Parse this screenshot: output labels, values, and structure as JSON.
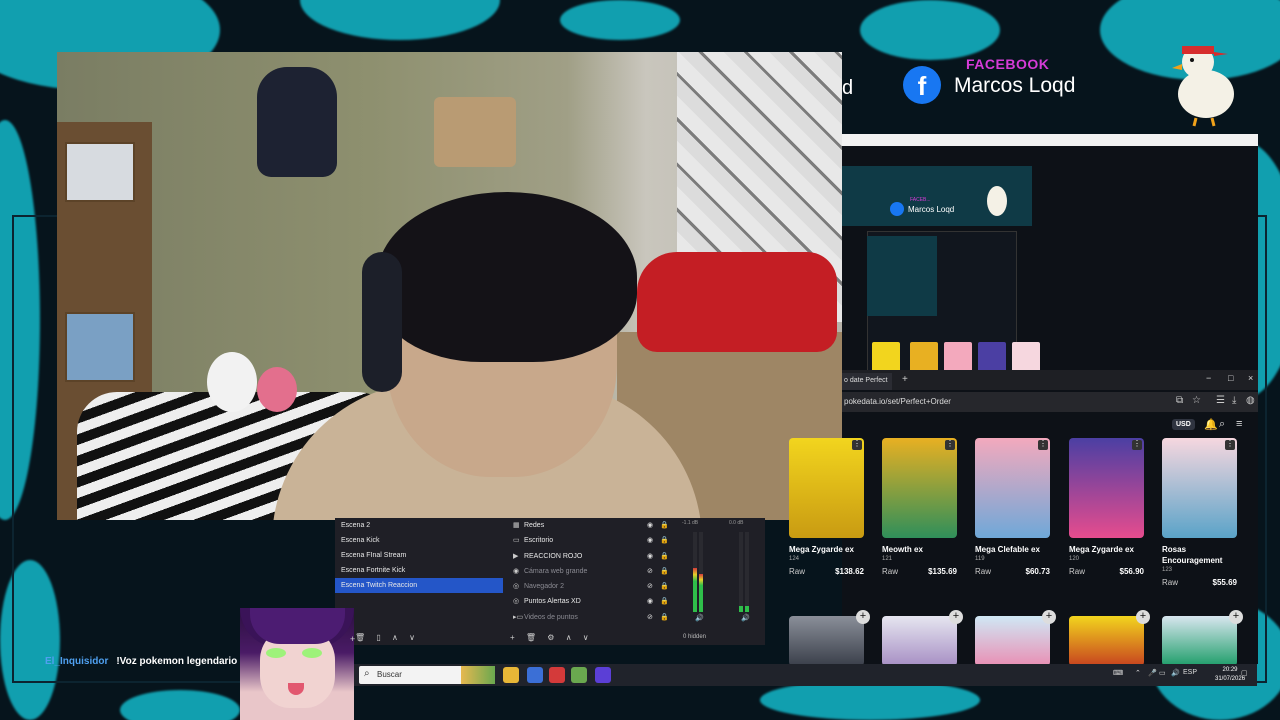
{
  "colors": {
    "accent_cyan": "#14b8c9",
    "background": "#06141c",
    "obs_selected": "#2456c8",
    "facebook_blue": "#1877f2",
    "facebook_label": "#d63bd8",
    "chat_user": "#4fa0f0"
  },
  "overlay": {
    "facebook_label": "FACEBOOK",
    "facebook_icon": "f",
    "facebook_name": "Marcos Loqd",
    "partial_text": "d",
    "nested_facebook_name": "Marcos Loqd",
    "nested_facebook_label": "FACEB..."
  },
  "browser": {
    "tab_title": "o date Perfect",
    "new_tab": "+",
    "window_controls": [
      "−",
      "□",
      "×"
    ],
    "address": "pokedata.io/set/Perfect+Order",
    "currency": "USD",
    "cards_row1": [
      {
        "name": "Mega Zygarde ex",
        "number": "124",
        "label": "Raw",
        "price": "$138.62",
        "color_top": "#f2d51e",
        "color_bottom": "#c99b12"
      },
      {
        "name": "Meowth ex",
        "number": "121",
        "label": "Raw",
        "price": "$135.69",
        "color_top": "#e8b022",
        "color_bottom": "#2f8f5a"
      },
      {
        "name": "Mega Clefable ex",
        "number": "119",
        "label": "Raw",
        "price": "$60.73",
        "color_top": "#f3a9bd",
        "color_bottom": "#6fa8d8"
      },
      {
        "name": "Mega Zygarde ex",
        "number": "120",
        "label": "Raw",
        "price": "$56.90",
        "color_top": "#4b3fa3",
        "color_bottom": "#e64c8e"
      },
      {
        "name": "Rosas Encouragement",
        "number": "123",
        "label": "Raw",
        "price": "$55.69",
        "color_top": "#f6d7df",
        "color_bottom": "#5aa3c8"
      }
    ],
    "cards_row2": [
      {
        "color_top": "#8a8f99",
        "color_bottom": "#3a3f4a"
      },
      {
        "color_top": "#e6e6f0",
        "color_bottom": "#a78fc4"
      },
      {
        "color_top": "#cfe8f5",
        "color_bottom": "#e98fb4"
      },
      {
        "color_top": "#f2d51e",
        "color_bottom": "#c7431f"
      },
      {
        "color_top": "#d8e6ef",
        "color_bottom": "#1f9e6a"
      }
    ]
  },
  "obs": {
    "scenes": [
      "Escena 2",
      "Escena Kick",
      "Escena FInal Stream",
      "Escena Fortnite Kick",
      "Escena Twitch Reaccion"
    ],
    "sources": [
      {
        "icon": "▦",
        "label": "Redes",
        "dim": false
      },
      {
        "icon": "▭",
        "label": "Escritorio",
        "dim": false
      },
      {
        "icon": "▶",
        "label": "REACCION ROJO",
        "dim": false
      },
      {
        "icon": "◉",
        "label": "Cámara web grande",
        "dim": true
      },
      {
        "icon": "◎",
        "label": "Navegador 2",
        "dim": true
      },
      {
        "icon": "◎",
        "label": "Puntos Alertas XD",
        "dim": false
      },
      {
        "icon": "▸▭",
        "label": "Videos de puntos",
        "dim": true
      }
    ],
    "scene_toolbar": [
      "+",
      "🗑",
      "▯",
      "∧",
      "∨"
    ],
    "source_toolbar": [
      "+",
      "🗑",
      "⚙",
      "∧",
      "∨"
    ],
    "hidden_count": "0 hidden",
    "db_label_1": "-1.1 dB",
    "db_label_2": "0.0 dB"
  },
  "taskbar": {
    "search_placeholder": "Buscar",
    "language": "ESP",
    "time": "20:29",
    "date": "31/07/2026"
  },
  "chat": {
    "user": "El_Inquisidor",
    "message": "!Voz pokemon legendario o"
  }
}
